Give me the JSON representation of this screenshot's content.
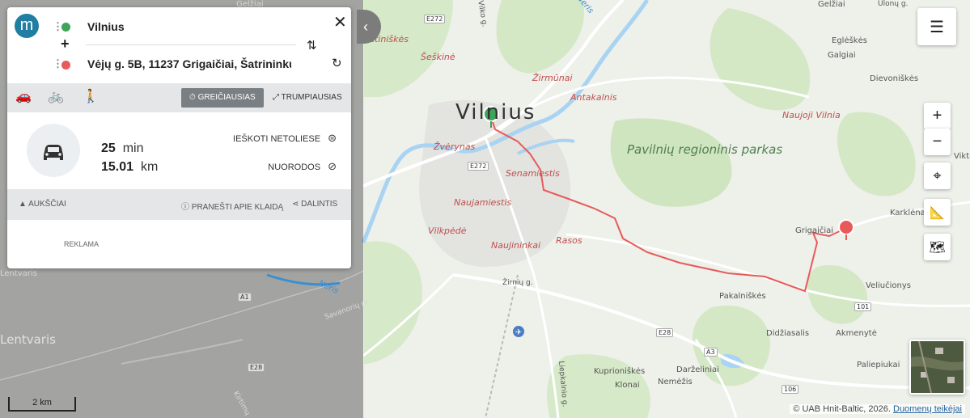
{
  "app": {
    "logo_letter": "m"
  },
  "route": {
    "origin": "Vilnius",
    "destination": "Vėjų g. 5B, 11237 Grigaičiai, Šatrininkų",
    "modes": [
      "car-icon",
      "bike-icon",
      "walk-icon"
    ],
    "options": {
      "fastest": "GREIČIAUSIAS",
      "shortest": "TRUMPIAUSIAS"
    },
    "duration_value": "25",
    "duration_unit": "min",
    "distance_value": "15.01",
    "distance_unit": "km",
    "actions": {
      "search_nearby": "IEŠKOTI NETOLIESE",
      "directions": "NUORODOS"
    },
    "info": {
      "elevation": "AUKŠČIAI",
      "report": "PRANEŠTI APIE KLAIDĄ",
      "share": "DALINTIS"
    },
    "ad_label": "REKLAMA"
  },
  "map": {
    "city": "Vilnius",
    "park": "Pavilnių regioninis parkas",
    "districts": [
      "Justiniškės",
      "Šeškinė",
      "Žirmūnai",
      "Antakalnis",
      "Žvėrynas",
      "Senamiestis",
      "Naujamiestis",
      "Vilkpėdė",
      "Naujininkai",
      "Rasos",
      "Naujoji Vilnia"
    ],
    "places": [
      "Gelžiai",
      "Eglėškės",
      "Galgiai",
      "Dievoniškės",
      "Viktariškės",
      "Karklėnai",
      "Grigaičiai",
      "Veliučionys",
      "Pakalniškės",
      "Didžiasalis",
      "Akmenytė",
      "Paliepiukai",
      "Kuprioniškės",
      "Klonai",
      "Nemėžis",
      "Darželiniai"
    ],
    "dim_places": [
      "Gelžiai",
      "Lentvaris",
      "Lentvaris",
      "Savanorių pr.",
      "Kirtimų"
    ],
    "roads": [
      "E272",
      "E272",
      "E28",
      "E28",
      "A1",
      "A3",
      "101",
      "106"
    ],
    "street_labels": [
      "Žirnių g.",
      "Liepkalnio g.",
      "Ulonų g.",
      "Vilko g."
    ],
    "rivers": [
      "Neris",
      "Neris"
    ]
  },
  "scale_label": "2 km",
  "attribution": {
    "text": "© UAB Hnit-Baltic, 2026.",
    "link": "Duomenų teikėjai"
  },
  "colors": {
    "route": "#e85a5a",
    "accent": "#1f7ea1",
    "panel_gray": "#e5e6e8"
  }
}
